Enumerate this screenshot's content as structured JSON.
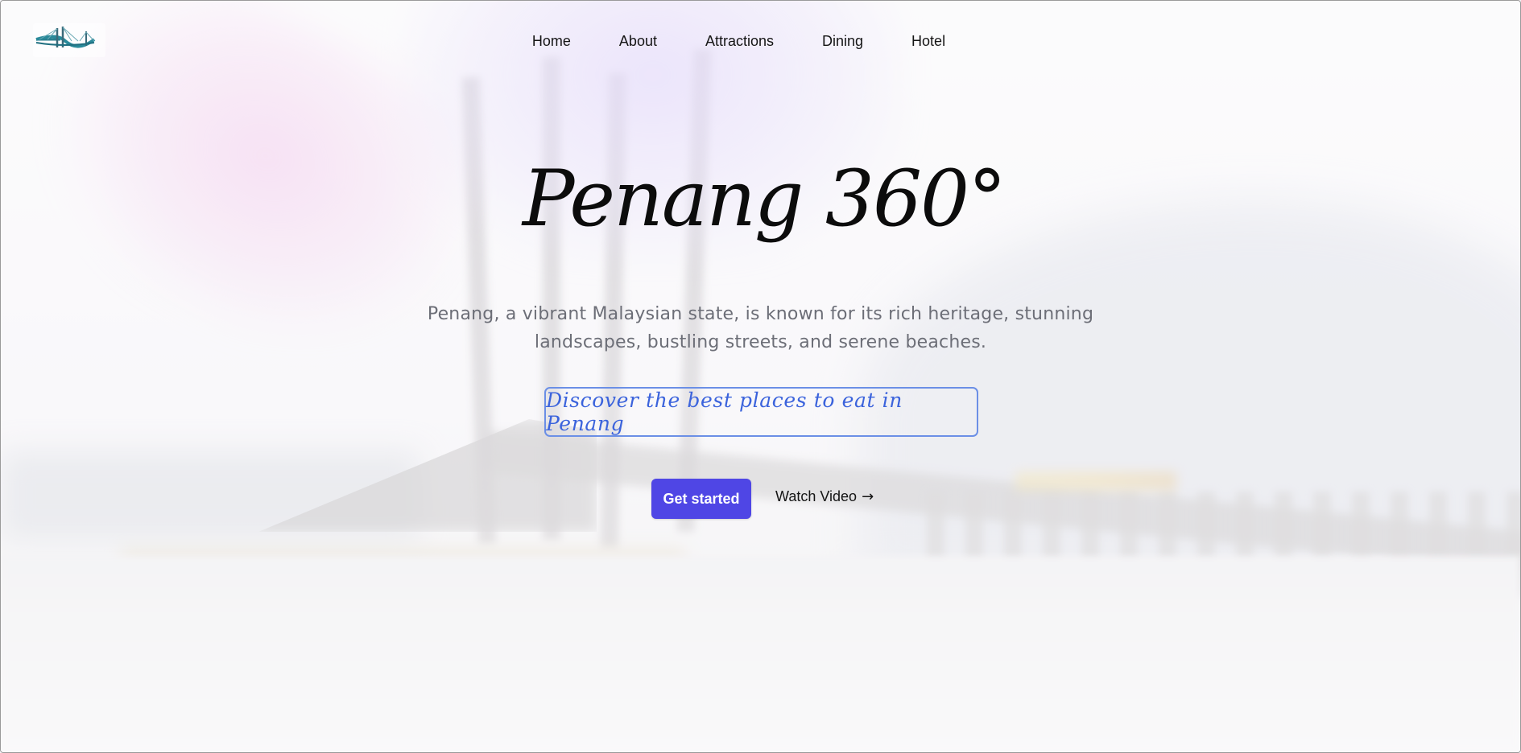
{
  "header": {
    "logo_icon": "penang-bridge-logo-icon",
    "nav": [
      {
        "label": "Home"
      },
      {
        "label": "About"
      },
      {
        "label": "Attractions"
      },
      {
        "label": "Dining"
      },
      {
        "label": "Hotel"
      }
    ]
  },
  "hero": {
    "title": "Penang 360°",
    "description": "Penang, a vibrant Malaysian state, is known for its rich heritage, stunning landscapes, bustling streets, and serene beaches.",
    "cta_text": "Discover the best places to eat in Penang",
    "primary_button": "Get started",
    "secondary_button": "Watch Video",
    "secondary_icon": "arrow-right-icon",
    "secondary_glyph": "→"
  },
  "colors": {
    "accent": "#4f46e5",
    "cta_border": "#6b8fe6",
    "cta_text": "#3b63dc",
    "description_text": "#6c6e77"
  }
}
